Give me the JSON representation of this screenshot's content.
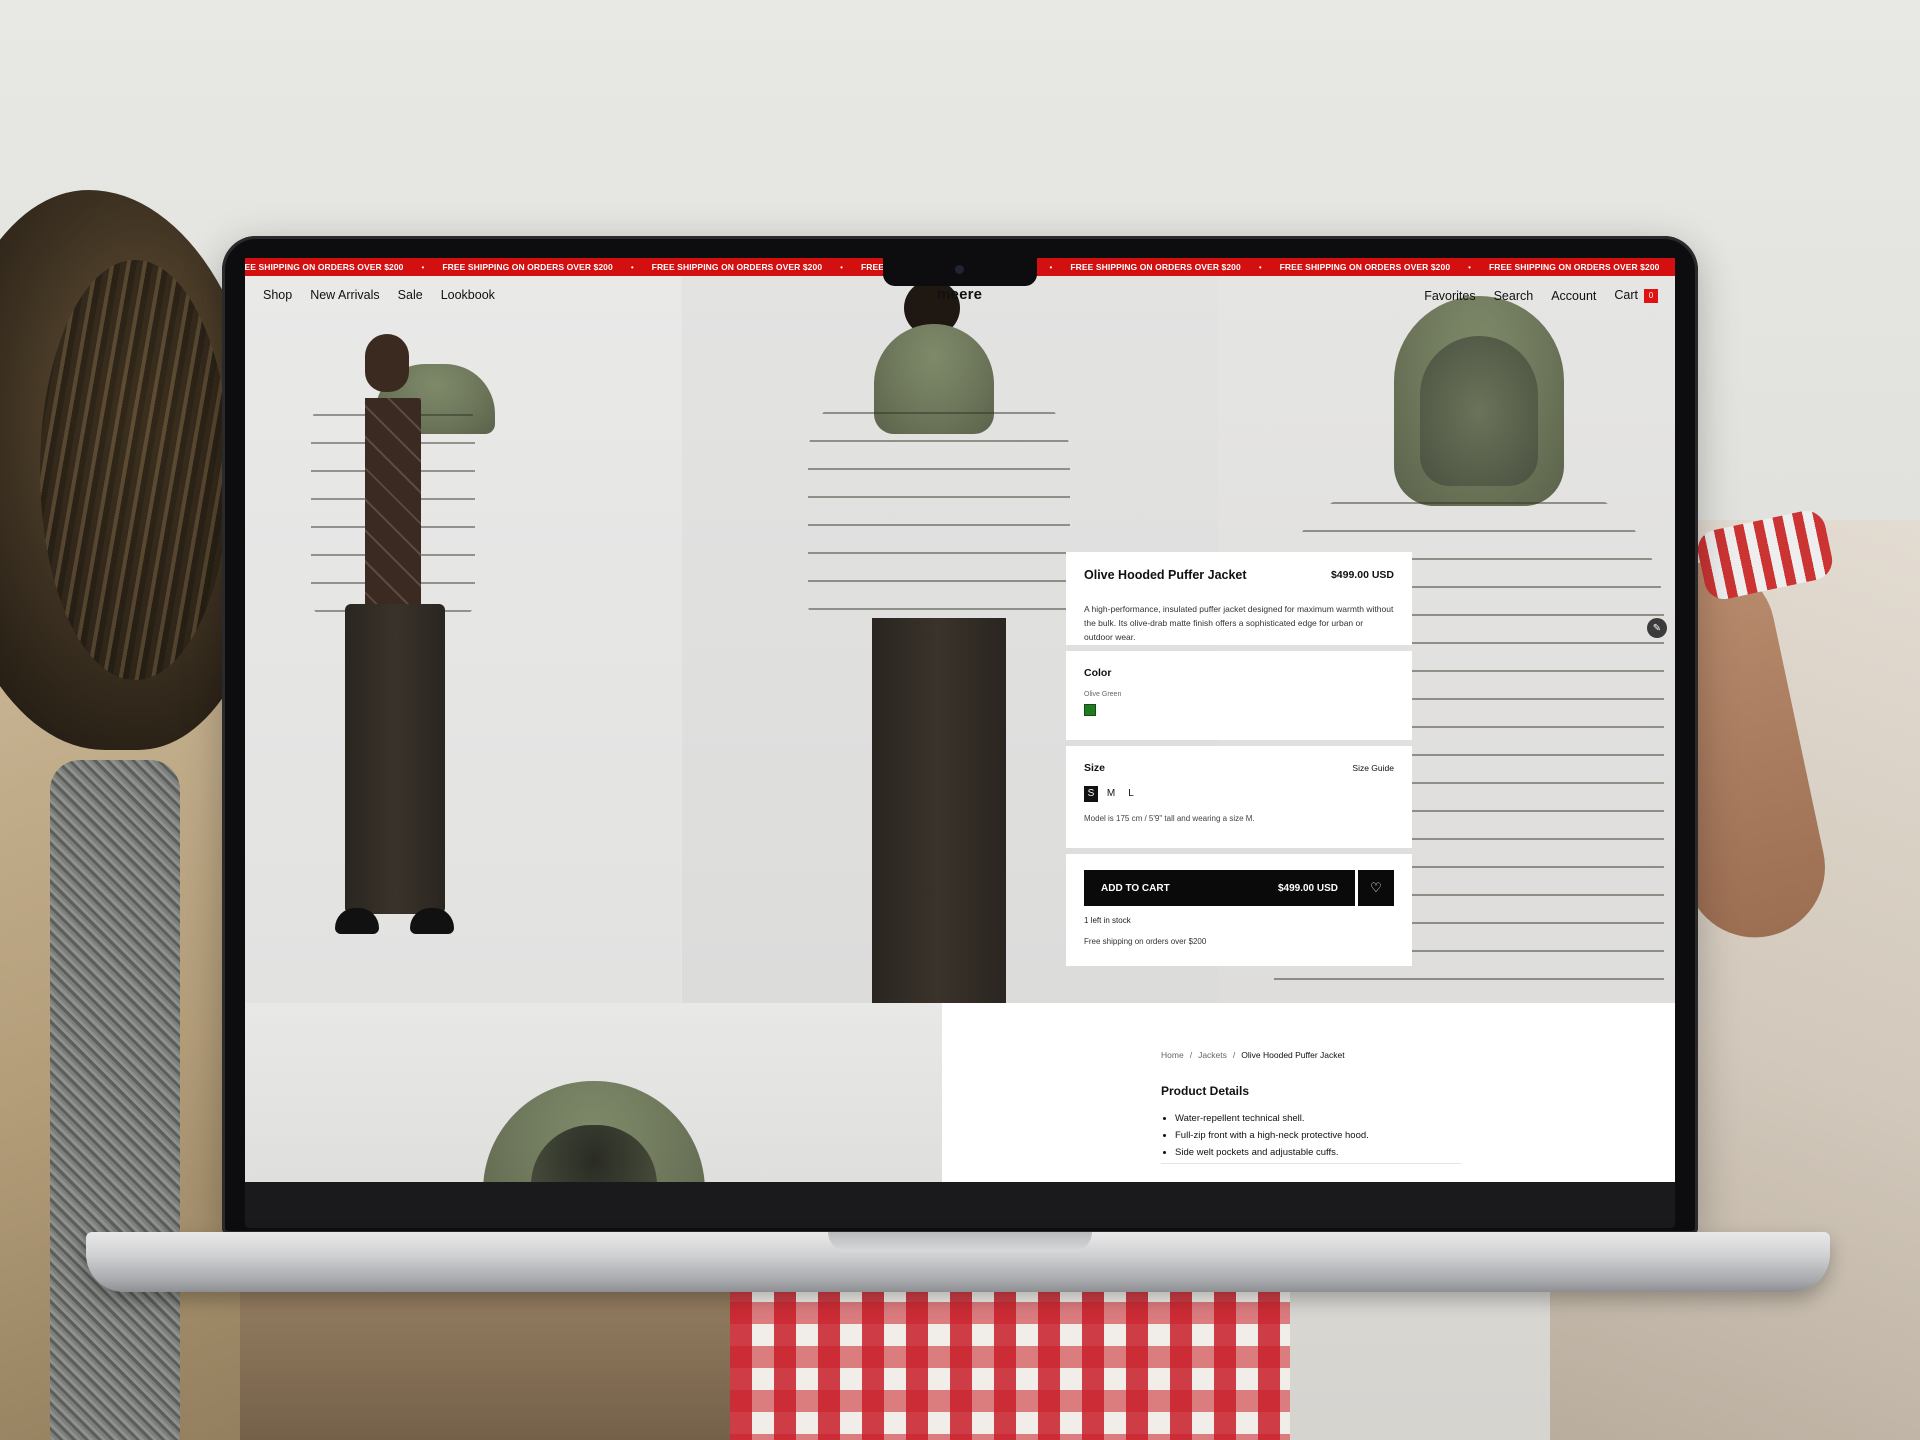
{
  "announcement": {
    "items": [
      "FREE SHIPPING ON ORDERS OVER $200",
      "FREE SHIPPING ON ORDERS OVER $200",
      "FREE SHIPPING ON ORDERS OVER $200",
      "FREE SHIPPING ON ORDERS OVER $200",
      "FREE SHIPPING ON ORDERS OVER $200",
      "FREE SHIPPING ON ORDERS OVER $200",
      "FREE SHIPPING ON ORDERS OVER $200",
      "FREE SHIPPING ON ORDERS OVER $200",
      "FREE SHIPPING ON ORDERS OVER $200",
      "FREE SHIPPING ON ORDERS OVER $200"
    ],
    "color": "#d40f0f"
  },
  "nav": {
    "left": [
      "Shop",
      "New Arrivals",
      "Sale",
      "Lookbook"
    ],
    "logo": "meere",
    "right": [
      "Favorites",
      "Search",
      "Account",
      "Cart"
    ],
    "cart_count": "0"
  },
  "product": {
    "name": "Olive Hooded Puffer Jacket",
    "price": "$499.00 USD",
    "description": "A high-performance, insulated puffer jacket designed for maximum warmth without the bulk. Its olive-drab matte finish offers a sophisticated edge for urban or outdoor wear.",
    "color_label": "Color",
    "color_name": "Olive Green",
    "swatch_color": "#1f7a20",
    "size_label": "Size",
    "size_guide": "Size Guide",
    "sizes": [
      "S",
      "M",
      "L"
    ],
    "selected_size": "S",
    "model_note": "Model is 175 cm / 5'9\" tall and wearing a size M.",
    "add_to_cart": "ADD TO CART",
    "stock": "1 left in stock",
    "shipping_note": "Free shipping on orders over $200"
  },
  "breadcrumb": [
    "Home",
    "Jackets",
    "Olive Hooded Puffer Jacket"
  ],
  "details": {
    "title": "Product Details",
    "bullets": [
      "Water-repellent technical shell.",
      "Full-zip front with a high-neck protective hood.",
      "Side welt pockets and adjustable cuffs."
    ]
  },
  "icons": {
    "favorite": "heart-icon",
    "edit": "pencil-icon"
  }
}
